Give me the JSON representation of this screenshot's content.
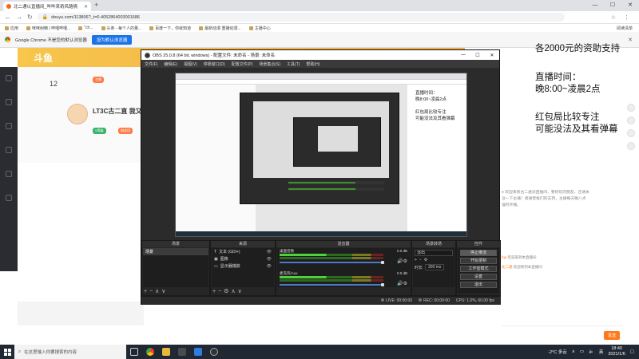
{
  "browser": {
    "tab_title": "北二通以直播间_哔哔来奇风路情",
    "url": "douyu.com/113806?_t=0.4052864003001686",
    "bookmarks": [
      "应用",
      "咪咪树精 | 哔哩哔哩...",
      "\"ch...",
      "头条 - 每个人的量...",
      "百度一下，你就知道",
      "最新动漫 重播动漫...",
      "主播中心"
    ],
    "reading_list": "阅读清单",
    "infobar_text": "Google Chrome 不是您的默认浏览器",
    "infobar_button": "设为默认浏览器"
  },
  "page": {
    "site_logo": "斗鱼",
    "room_number": "12",
    "room_title": "LT3C古二直 我又开",
    "badges": [
      "主播",
      "V等级",
      "粉丝团"
    ],
    "overlay_top": "各2000元的资助支持",
    "overlay_time_label": "直播时间：",
    "overlay_time": "晚8:00~凌晨2点",
    "overlay_note1": "红包局比较专注",
    "overlay_note2": "可能没法及其看弹幕",
    "description": "欢迎来到古二通没直播间，要好玩的朋友，还请关注一下主播！感谢老板们的支持，主播每天晚八点准时开播。",
    "chat_lines": [
      {
        "user": "fqa",
        "text": "欢迎来到本直播间"
      },
      {
        "user": "北二通",
        "text": "欢迎来到本直播间"
      }
    ],
    "send_label": "发送"
  },
  "obs": {
    "title": "OBS 25.0.8 (64 bit, windows) - 配置文件: 未命名 - 场景: 未命名",
    "menu": [
      "文件(F)",
      "编辑(E)",
      "视图(V)",
      "停靠窗口(D)",
      "配置文件(P)",
      "场景集合(S)",
      "工具(T)",
      "帮助(H)"
    ],
    "preview_overlay": [
      "直播时间：",
      "晚8:00~凌晨2点",
      "红包局比较专注",
      "可能没法及其看弹幕"
    ],
    "docks": {
      "scenes_title": "场景",
      "sources_title": "来源",
      "mixer_title": "混音器",
      "transitions_title": "场景转场",
      "controls_title": "控件"
    },
    "scenes": [
      "场景"
    ],
    "sources": [
      "文本 (GDI+)",
      "图像",
      "显示器捕获"
    ],
    "mixer": [
      {
        "name": "桌面音频",
        "db": "0.0 dB"
      },
      {
        "name": "麦克风/Aux",
        "db": "0.0 dB"
      }
    ],
    "transition": "淡出",
    "duration_label": "时长",
    "duration_value": "300 ms",
    "controls": [
      "停止推流",
      "开始录制",
      "工作室模式",
      "设置",
      "退出"
    ],
    "status": {
      "live": "LIVE: 00:00:00",
      "rec": "REC: 00:00:00",
      "cpu": "CPU: 1.0%, 60.00 fps"
    }
  },
  "taskbar": {
    "search_placeholder": "在这里输入你要搜索的内容",
    "weather": "-2°C 多云",
    "time": "18:40",
    "date": "2021/1/6",
    "ime": "英"
  }
}
